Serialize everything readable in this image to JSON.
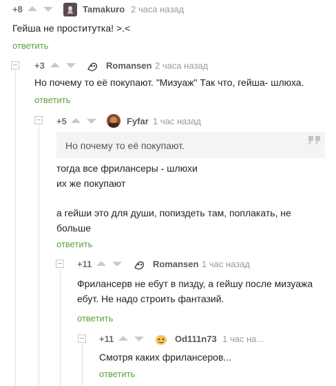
{
  "comments": [
    {
      "rating": "+8",
      "author": "Tamakuro",
      "time": "2 часа назад",
      "lines": [
        "Гейша не проститутка! >.<"
      ],
      "reply": "ответить"
    },
    {
      "rating": "+3",
      "author": "Romansen",
      "time": "2 часа назад",
      "lines": [
        "Но почему то её  покупают. \"Мизуаж\" Так что, гейша- шлюха."
      ],
      "reply": "ответить"
    },
    {
      "rating": "+5",
      "author": "Fyfar",
      "time": "1 час назад",
      "quote": "Но почему то её покупают.",
      "lines": [
        "тогда все фрилансеры - шлюхи",
        "их же покупают",
        "а гейши это для души, попиздеть там, поплакать, не",
        "больше"
      ],
      "reply": "ответить"
    },
    {
      "rating": "+11",
      "author": "Romansen",
      "time": "1 час назад",
      "lines": [
        "Фрилансерв не ебут в пизду, а гейшу после мизуажа",
        "ебут. Не надо строить фантазий."
      ],
      "reply": "ответить"
    },
    {
      "rating": "+11",
      "author": "Od111n73",
      "time": "1 час на...",
      "lines": [
        "Смотря каких фрилансеров..."
      ],
      "reply": "ответить"
    }
  ],
  "colors": {
    "reply_link": "#58a33e",
    "arrow": "#c9c9c9",
    "quote_bg": "#f4f4f4"
  },
  "icons": {
    "up": "arrow-up-icon",
    "down": "arrow-down-icon",
    "collapse": "collapse-icon",
    "quote": "quote-mark-icon"
  }
}
